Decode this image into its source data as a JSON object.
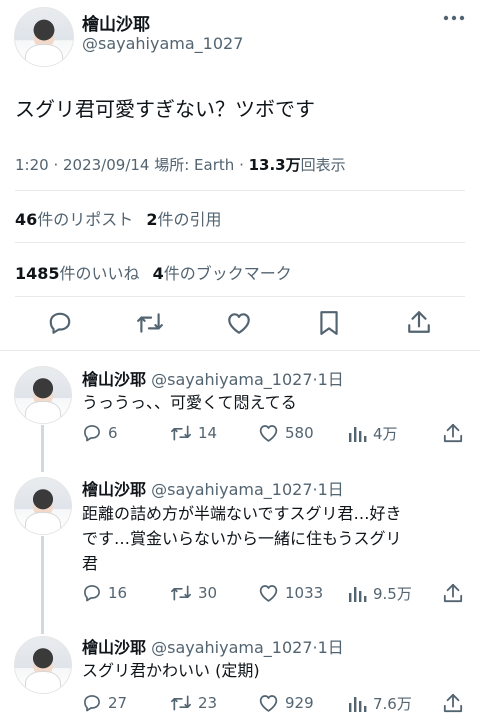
{
  "main": {
    "author": {
      "name": "檜山沙耶",
      "handle": "@sayahiyama_1027"
    },
    "text": "スグリ君可愛すぎない？ツボです",
    "meta": {
      "time": "1:20",
      "sep1": " · ",
      "date": "2023/09/14",
      "location": " 場所: Earth",
      "sep2": " · ",
      "views": "13.3万",
      "views_label": "回表示"
    },
    "reposts": {
      "count": "46",
      "label": "件のリポスト"
    },
    "quotes": {
      "count": "2",
      "label": "件の引用"
    },
    "likes": {
      "count": "1485",
      "label": "件のいいね"
    },
    "bookmarks": {
      "count": "4",
      "label": "件のブックマーク"
    }
  },
  "replies": [
    {
      "name": "檜山沙耶",
      "handle": "@sayahiyama_1027",
      "time": "·1日",
      "lines": [
        "うっうっ、、可愛くて悶えてる"
      ],
      "stats": {
        "replies": "6",
        "reposts": "14",
        "likes": "580",
        "views": "4万"
      }
    },
    {
      "name": "檜山沙耶",
      "handle": "@sayahiyama_1027",
      "time": "·1日",
      "lines": [
        "距離の詰め方が半端ないですスグリ君…好き",
        "です…賞金いらないから一緒に住もうスグリ",
        "君"
      ],
      "stats": {
        "replies": "16",
        "reposts": "30",
        "likes": "1033",
        "views": "9.5万"
      }
    },
    {
      "name": "檜山沙耶",
      "handle": "@sayahiyama_1027",
      "time": "·1日",
      "lines": [
        "スグリ君かわいい (定期)"
      ],
      "stats": {
        "replies": "27",
        "reposts": "23",
        "likes": "929",
        "views": "7.6万"
      }
    }
  ],
  "icons": [
    "more-icon",
    "reply-icon",
    "repost-icon",
    "like-icon",
    "bookmark-icon",
    "share-icon",
    "views-icon"
  ],
  "colors": {
    "text": "#0f1419",
    "secondary": "#536471",
    "divider": "#e7e9ea"
  }
}
